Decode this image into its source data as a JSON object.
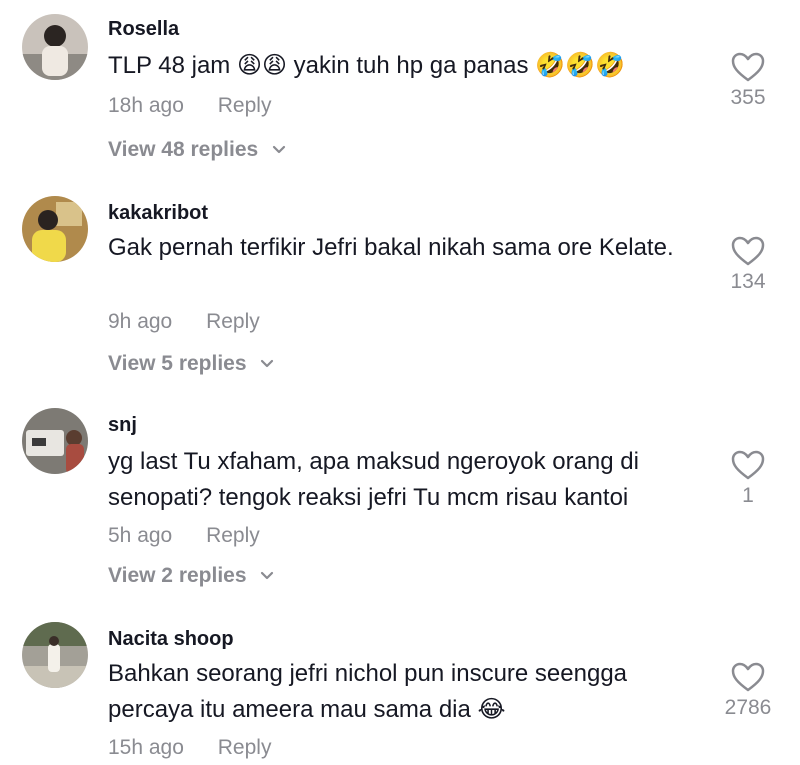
{
  "comments": [
    {
      "username": "Rosella",
      "text": "TLP 48 jam 😩😩  yakin tuh hp ga panas 🤣🤣🤣",
      "time": "18h ago",
      "reply": "Reply",
      "view_replies": "View 48 replies",
      "likes": "355"
    },
    {
      "username": "kakakribot",
      "text": "Gak pernah terfikir Jefri bakal nikah sama ore Kelate.",
      "time": "9h ago",
      "reply": "Reply",
      "view_replies": "View 5 replies",
      "likes": "134"
    },
    {
      "username": "snj",
      "text": "yg last Tu xfaham, apa maksud ngeroyok orang di senopati? tengok reaksi jefri Tu mcm risau kantoi",
      "time": "5h ago",
      "reply": "Reply",
      "view_replies": "View 2 replies",
      "likes": "1"
    },
    {
      "username": "Nacita shoop",
      "text": "Bahkan seorang jefri nichol pun inscure seengga percaya itu ameera mau sama dia 😂",
      "time": "15h ago",
      "reply": "Reply",
      "likes": "2786"
    }
  ],
  "icons": {
    "like": "heart-outline-icon",
    "expand": "chevron-down-icon"
  },
  "colors": {
    "text": "#161823",
    "muted": "#8a8b91"
  }
}
